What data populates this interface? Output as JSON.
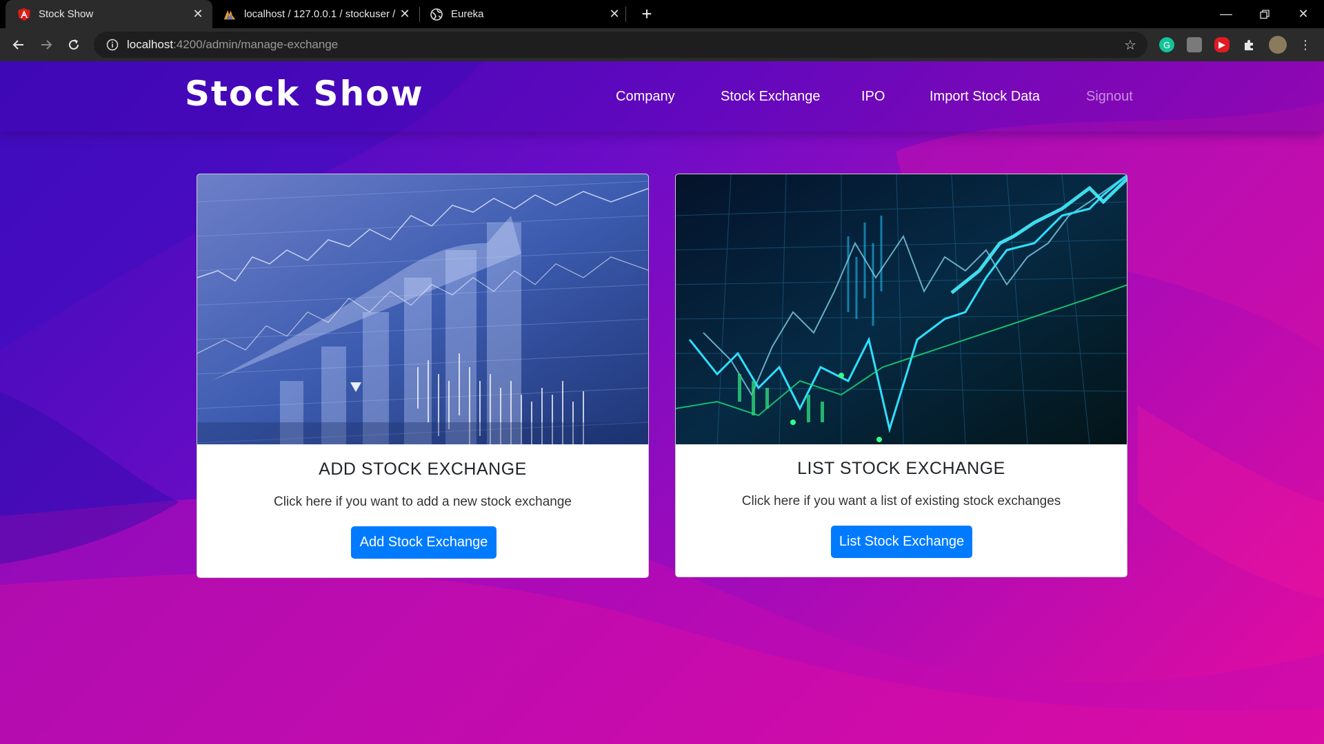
{
  "browser": {
    "tabs": [
      {
        "title": "Stock Show",
        "icon": "angular-icon",
        "active": true
      },
      {
        "title": "localhost / 127.0.0.1 / stockuser / ",
        "icon": "phpmyadmin-icon",
        "active": false
      },
      {
        "title": "Eureka",
        "icon": "globe-icon",
        "active": false
      }
    ],
    "address": {
      "host": "localhost",
      "path": ":4200/admin/manage-exchange"
    },
    "colors": {
      "tabstrip": "#000000",
      "toolbar": "#2b2b2b",
      "omnibox": "#1e1e1e"
    }
  },
  "site": {
    "brand": "Stock Show",
    "nav": [
      {
        "label": "Company"
      },
      {
        "label": "Stock Exchange"
      },
      {
        "label": "IPO"
      },
      {
        "label": "Import Stock Data"
      },
      {
        "label": "Signout"
      }
    ],
    "colors": {
      "primary": "#007bff",
      "gradient_start": "#3a0db8",
      "gradient_end": "#e50c9e"
    }
  },
  "cards": [
    {
      "title": "ADD STOCK EXCHANGE",
      "text": "Click here if you want to add a new stock exchange",
      "button": "Add Stock Exchange",
      "image": "blue stock market chart"
    },
    {
      "title": "LIST STOCK EXCHANGE",
      "text": "Click here if you want a list of existing stock exchanges",
      "button": "List Stock Exchange",
      "image": "green-blue neon stock chart"
    }
  ]
}
